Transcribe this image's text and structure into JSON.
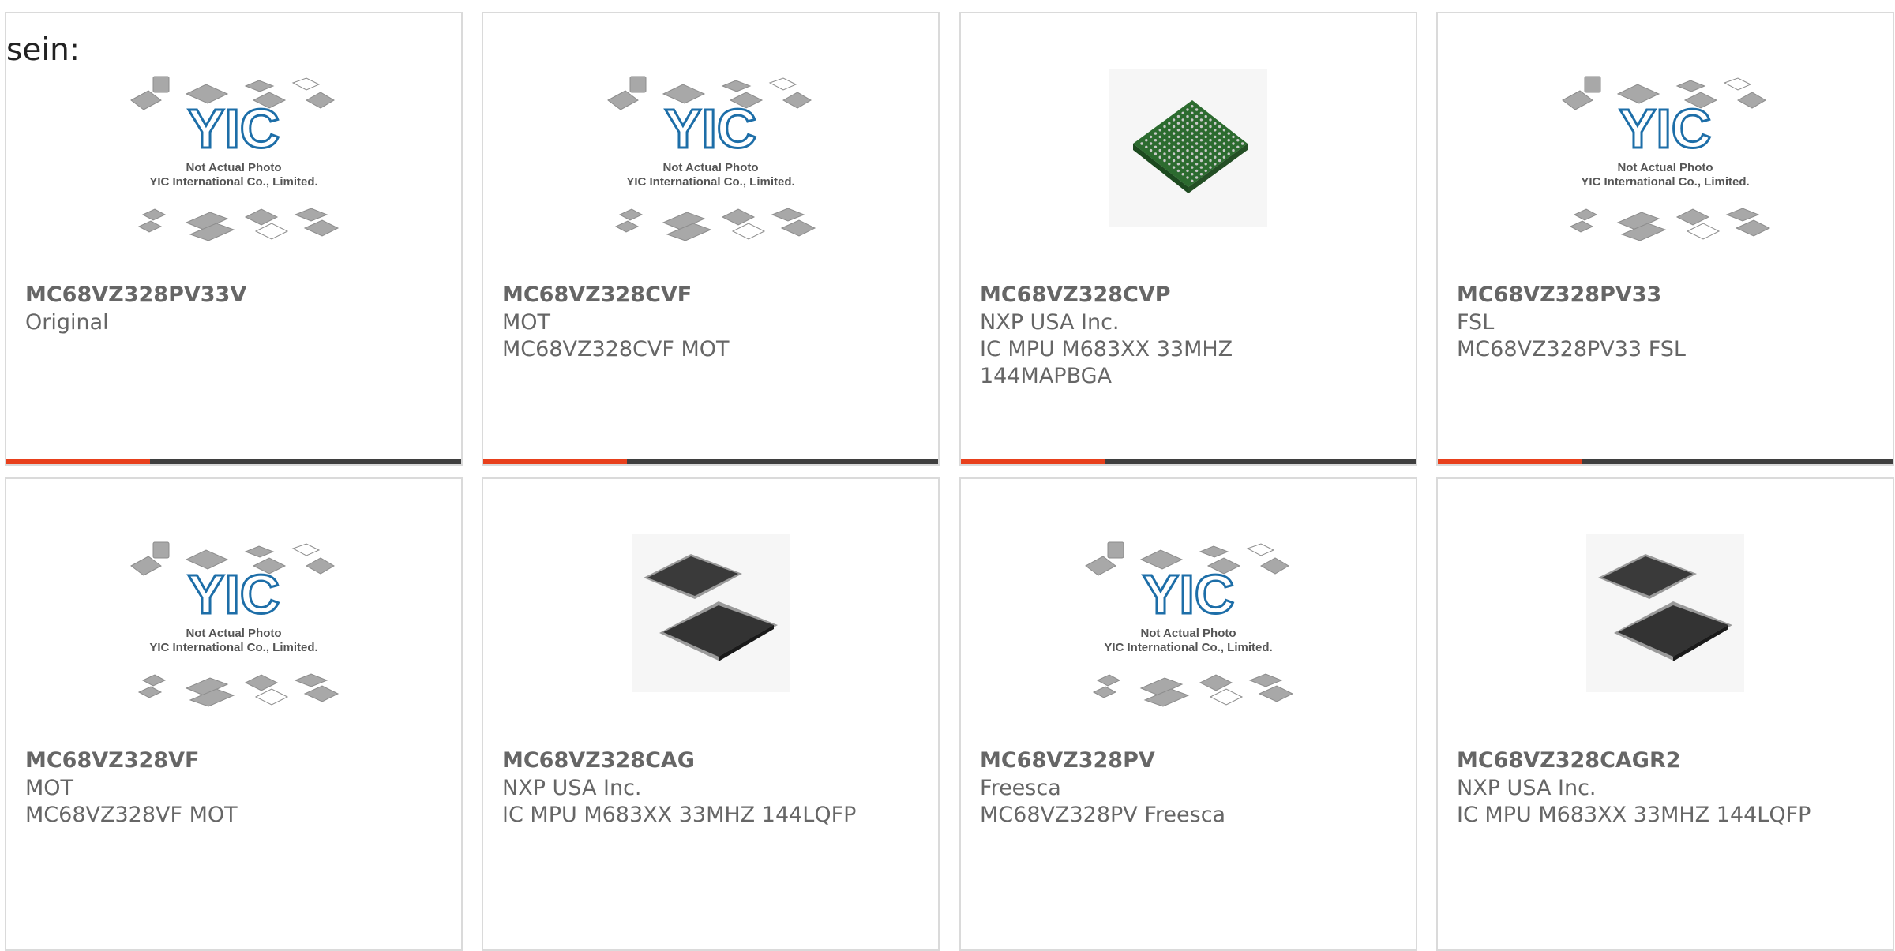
{
  "heading": "sein:",
  "placeholder": {
    "logo_text": "YIC",
    "line1": "Not Actual Photo",
    "line2": "YIC International Co., Limited."
  },
  "colors": {
    "accent": "#e8401c",
    "bar": "#3f3f3f",
    "text": "#666666",
    "border": "#dadada"
  },
  "products": [
    {
      "part": "MC68VZ328PV33V",
      "line1": "Original",
      "line2": "",
      "image": "yic-placeholder"
    },
    {
      "part": "MC68VZ328CVF",
      "line1": "MOT",
      "line2": "MC68VZ328CVF MOT",
      "image": "yic-placeholder"
    },
    {
      "part": "MC68VZ328CVP",
      "line1": "NXP USA Inc.",
      "line2": "IC MPU M683XX 33MHZ 144MAPBGA",
      "image": "bga-chip"
    },
    {
      "part": "MC68VZ328PV33",
      "line1": "FSL",
      "line2": "MC68VZ328PV33 FSL",
      "image": "yic-placeholder"
    },
    {
      "part": "MC68VZ328VF",
      "line1": "MOT",
      "line2": "MC68VZ328VF MOT",
      "image": "yic-placeholder"
    },
    {
      "part": "MC68VZ328CAG",
      "line1": "NXP USA Inc.",
      "line2": "IC MPU M683XX 33MHZ 144LQFP",
      "image": "lqfp-chip"
    },
    {
      "part": "MC68VZ328PV",
      "line1": "Freesca",
      "line2": "MC68VZ328PV Freesca",
      "image": "yic-placeholder"
    },
    {
      "part": "MC68VZ328CAGR2",
      "line1": "NXP USA Inc.",
      "line2": "IC MPU M683XX 33MHZ 144LQFP",
      "image": "lqfp-chip"
    }
  ]
}
